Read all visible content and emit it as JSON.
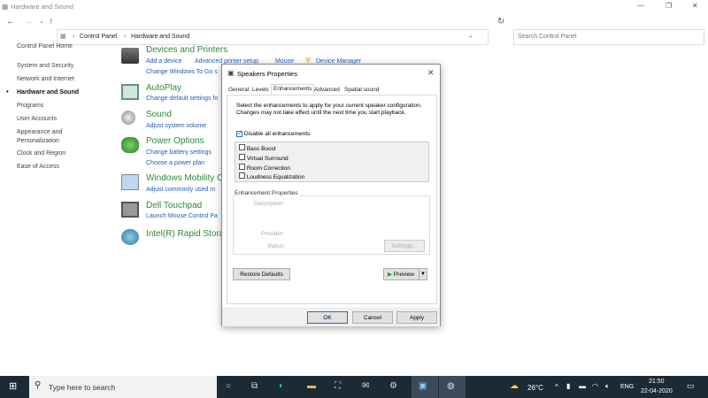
{
  "window": {
    "title": "Hardware and Sound"
  },
  "address": {
    "crumbs": [
      "Control Panel",
      "Hardware and Sound"
    ],
    "search_placeholder": "Search Control Panel"
  },
  "nav": {
    "items": [
      "Control Panel Home",
      "System and Security",
      "Network and Internet",
      "Hardware and Sound",
      "Programs",
      "User Accounts",
      "Appearance and",
      "Personalization",
      "Clock and Region",
      "Ease of Access"
    ]
  },
  "categories": [
    {
      "title": "Devices and Printers",
      "links": [
        "Add a device",
        "Advanced printer setup",
        "Mouse",
        "Device Manager",
        "Change Windows To Go s"
      ]
    },
    {
      "title": "AutoPlay",
      "links": [
        "Change default settings fo"
      ]
    },
    {
      "title": "Sound",
      "links": [
        "Adjust system volume"
      ]
    },
    {
      "title": "Power Options",
      "links": [
        "Change battery settings",
        "Choose a power plan"
      ]
    },
    {
      "title": "Windows Mobility C",
      "links": [
        "Adjust commonly used m"
      ]
    },
    {
      "title": "Dell Touchpad",
      "links": [
        "Launch Mouse Control Pa"
      ]
    },
    {
      "title": "Intel(R) Rapid Stora",
      "links": []
    }
  ],
  "dialog": {
    "title": "Speakers Properties",
    "tabs": [
      "General",
      "Levels",
      "Enhancements",
      "Advanced",
      "Spatial sound"
    ],
    "active_tab": "Enhancements",
    "description": "Select the enhancements to apply for your current speaker configuration. Changes may not take effect until the next time you start playback.",
    "disable_all": {
      "label": "Disable all enhancements",
      "checked": true
    },
    "enhancements": [
      "Bass Boost",
      "Virtual Surround",
      "Room Correction",
      "Loudness Equalization"
    ],
    "group_title": "Enhancement Properties",
    "description_label": "Description:",
    "provider_label": "Provider:",
    "status_label": "Status:",
    "settings_btn": "Settings...",
    "restore_btn": "Restore Defaults",
    "preview_btn": "Preview",
    "ok": "OK",
    "cancel": "Cancel",
    "apply": "Apply"
  },
  "taskbar": {
    "search_placeholder": "Type here to search",
    "temp": "26°C",
    "lang": "ENG",
    "time": "21:50",
    "date": "22-04-2020"
  }
}
